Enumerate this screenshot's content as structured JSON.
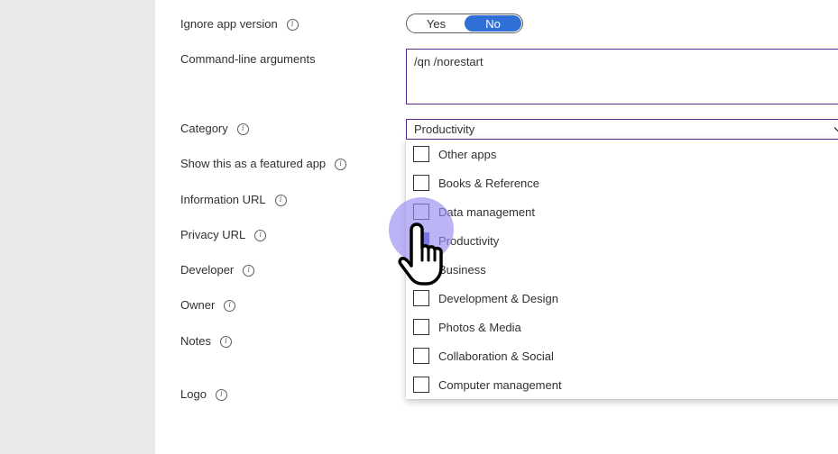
{
  "form": {
    "ignore_app_version": {
      "label": "Ignore app version",
      "options": [
        "Yes",
        "No"
      ],
      "selected": "No"
    },
    "command_line": {
      "label": "Command-line arguments",
      "value": "/qn /norestart"
    },
    "category": {
      "label": "Category",
      "selected_value": "Productivity",
      "options": [
        {
          "label": "Other apps",
          "checked": false
        },
        {
          "label": "Books & Reference",
          "checked": false
        },
        {
          "label": "Data management",
          "checked": false
        },
        {
          "label": "Productivity",
          "checked": true
        },
        {
          "label": "Business",
          "checked": false
        },
        {
          "label": "Development & Design",
          "checked": false
        },
        {
          "label": "Photos & Media",
          "checked": false
        },
        {
          "label": "Collaboration & Social",
          "checked": false
        },
        {
          "label": "Computer management",
          "checked": false
        }
      ]
    },
    "featured": {
      "label": "Show this as a featured app"
    },
    "information_url": {
      "label": "Information URL"
    },
    "privacy_url": {
      "label": "Privacy URL"
    },
    "developer": {
      "label": "Developer"
    },
    "owner": {
      "label": "Owner"
    },
    "notes": {
      "label": "Notes"
    },
    "logo": {
      "label": "Logo"
    }
  },
  "icons": {
    "info": "info-icon",
    "chevron": "chevron-down-icon",
    "cursor": "hand-pointer-icon"
  },
  "colors": {
    "accent": "#2f6fd6",
    "focus_border": "#5c2d91",
    "checkbox_checked": "#4a4ad0",
    "cursor_halo": "#968cf0"
  }
}
